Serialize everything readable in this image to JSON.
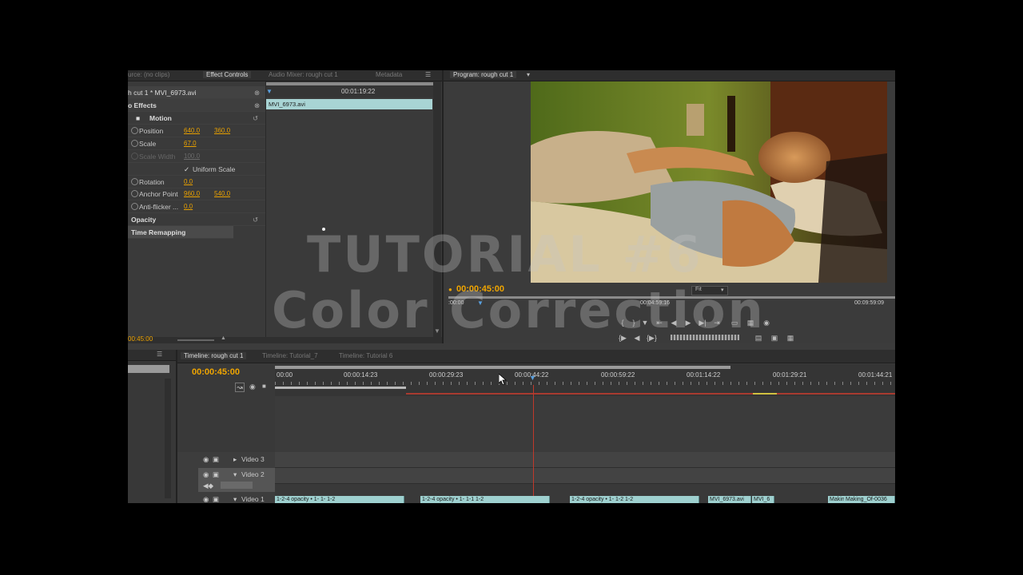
{
  "source_panel": {
    "tabs": [
      "urce: (no clips)",
      "Effect Controls",
      "Audio Mixer: rough cut 1",
      "Metadata"
    ],
    "menu_icon": "panel-menu-icon"
  },
  "effect_controls": {
    "sequence_clip": "h cut 1 * MVI_6973.avi",
    "timecode": "00:01:19:22",
    "clip_bar_label": "MVI_6973.avi",
    "section_label": "o Effects",
    "motion_label": "Motion",
    "position_label": "Position",
    "position_x": "640.0",
    "position_y": "360.0",
    "scale_label": "Scale",
    "scale_value": "67.0",
    "scale_width_label": "Scale Width",
    "scale_width_value": "100.0",
    "uniform_scale_label": "Uniform Scale",
    "rotation_label": "Rotation",
    "rotation_value": "0.0",
    "anchor_label": "Anchor Point",
    "anchor_x": "960.0",
    "anchor_y": "540.0",
    "antiflicker_label": "Anti-flicker ...",
    "antiflicker_value": "0.0",
    "opacity_label": "Opacity",
    "time_remap_label": "Time Remapping",
    "bottom_timecode": "00:45:00"
  },
  "program_monitor": {
    "tab": "Program: rough cut 1",
    "current_timecode": "00:00:45:00",
    "fit_label": "Fit",
    "ruler_start": ":00:00",
    "ruler_mid": "00:04:59:16",
    "ruler_end": "00:09:59:09"
  },
  "timeline": {
    "tabs": [
      "Timeline: rough cut 1",
      "Timeline: Tutorial_7",
      "Timeline: Tutorial 6"
    ],
    "current_timecode": "00:00:45:00",
    "ruler_labels": [
      "00:00",
      "00:00:14:23",
      "00:00:29:23",
      "00:00:44:22",
      "00:00:59:22",
      "00:01:14:22",
      "00:01:29:21",
      "00:01:44:21"
    ],
    "tracks": [
      "Video 3",
      "Video 2",
      "Video 1"
    ],
    "clips": [
      "1-2-4  opacity •  1-  1-  1-2",
      "1-2-4  opacity •  1-  1-1  1-2",
      "1-2-4  opacity •  1-  1-2  1-2",
      "MVI_6973.avi",
      "MVI_6",
      "Making",
      "Making_Of-0036"
    ]
  },
  "watermark": {
    "line1": "TUTORIAL #6",
    "line2": "Color Correction"
  },
  "colors": {
    "accent_timecode": "#f0a500",
    "clip": "#9ed0cf",
    "playhead": "#c0392b"
  }
}
